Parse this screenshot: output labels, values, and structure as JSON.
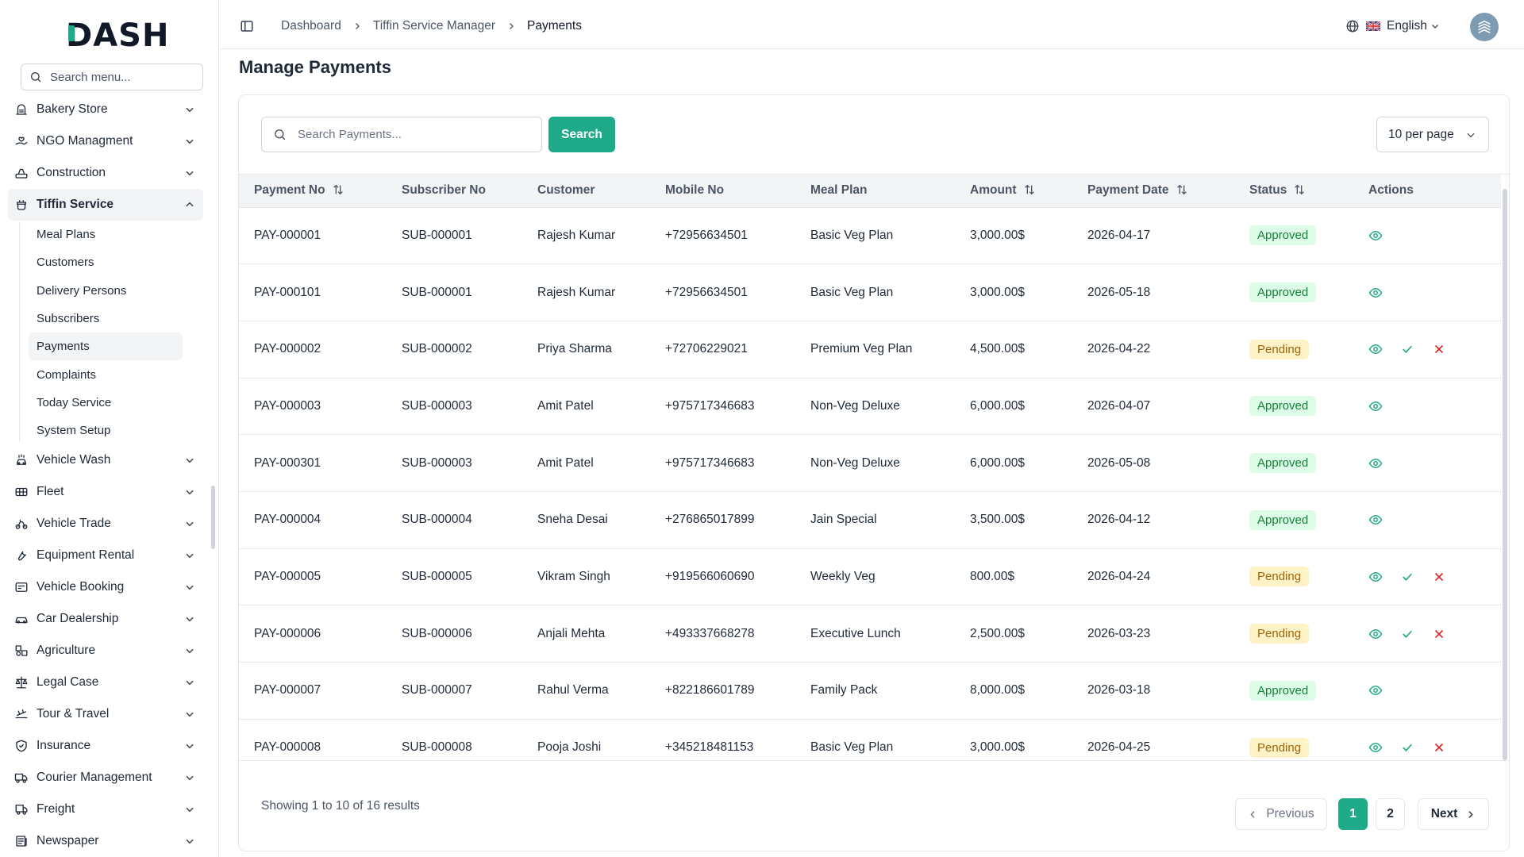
{
  "brand": {
    "logo_text": "DASH"
  },
  "sidebar": {
    "search_placeholder": "Search menu...",
    "items": [
      {
        "label": "Bakery Store",
        "icon": "bakery-icon"
      },
      {
        "label": "NGO Managment",
        "icon": "hand-heart-icon"
      },
      {
        "label": "Construction",
        "icon": "construction-icon"
      },
      {
        "label": "Tiffin Service",
        "icon": "tiffin-icon",
        "expanded": true
      },
      {
        "label": "Vehicle Wash",
        "icon": "car-wash-icon"
      },
      {
        "label": "Fleet",
        "icon": "fleet-icon"
      },
      {
        "label": "Vehicle Trade",
        "icon": "vehicle-trade-icon"
      },
      {
        "label": "Equipment Rental",
        "icon": "wrench-icon"
      },
      {
        "label": "Vehicle Booking",
        "icon": "booking-icon"
      },
      {
        "label": "Car Dealership",
        "icon": "car-icon"
      },
      {
        "label": "Agriculture",
        "icon": "agriculture-icon"
      },
      {
        "label": "Legal Case",
        "icon": "scale-icon"
      },
      {
        "label": "Tour & Travel",
        "icon": "travel-icon"
      },
      {
        "label": "Insurance",
        "icon": "shield-icon"
      },
      {
        "label": "Courier Management",
        "icon": "truck-icon"
      },
      {
        "label": "Freight",
        "icon": "freight-icon"
      },
      {
        "label": "Newspaper",
        "icon": "newspaper-icon"
      }
    ],
    "submenu": [
      {
        "label": "Meal Plans"
      },
      {
        "label": "Customers"
      },
      {
        "label": "Delivery Persons"
      },
      {
        "label": "Subscribers"
      },
      {
        "label": "Payments",
        "active": true
      },
      {
        "label": "Complaints"
      },
      {
        "label": "Today Service"
      },
      {
        "label": "System Setup"
      }
    ]
  },
  "header": {
    "breadcrumbs": [
      "Dashboard",
      "Tiffin Service Manager",
      "Payments"
    ],
    "language": "English"
  },
  "main": {
    "title": "Manage Payments",
    "search_placeholder": "Search Payments...",
    "search_button": "Search",
    "per_page": "10 per page",
    "columns": [
      "Payment No",
      "Subscriber No",
      "Customer",
      "Mobile No",
      "Meal Plan",
      "Amount",
      "Payment Date",
      "Status",
      "Actions"
    ],
    "rows": [
      {
        "payment_no": "PAY-000001",
        "subscriber_no": "SUB-000001",
        "customer": "Rajesh Kumar",
        "mobile": "+72956634501",
        "meal_plan": "Basic Veg Plan",
        "amount": "3,000.00$",
        "date": "2026-04-17",
        "status": "Approved"
      },
      {
        "payment_no": "PAY-000101",
        "subscriber_no": "SUB-000001",
        "customer": "Rajesh Kumar",
        "mobile": "+72956634501",
        "meal_plan": "Basic Veg Plan",
        "amount": "3,000.00$",
        "date": "2026-05-18",
        "status": "Approved"
      },
      {
        "payment_no": "PAY-000002",
        "subscriber_no": "SUB-000002",
        "customer": "Priya Sharma",
        "mobile": "+72706229021",
        "meal_plan": "Premium Veg Plan",
        "amount": "4,500.00$",
        "date": "2026-04-22",
        "status": "Pending"
      },
      {
        "payment_no": "PAY-000003",
        "subscriber_no": "SUB-000003",
        "customer": "Amit Patel",
        "mobile": "+975717346683",
        "meal_plan": "Non-Veg Deluxe",
        "amount": "6,000.00$",
        "date": "2026-04-07",
        "status": "Approved"
      },
      {
        "payment_no": "PAY-000301",
        "subscriber_no": "SUB-000003",
        "customer": "Amit Patel",
        "mobile": "+975717346683",
        "meal_plan": "Non-Veg Deluxe",
        "amount": "6,000.00$",
        "date": "2026-05-08",
        "status": "Approved"
      },
      {
        "payment_no": "PAY-000004",
        "subscriber_no": "SUB-000004",
        "customer": "Sneha Desai",
        "mobile": "+276865017899",
        "meal_plan": "Jain Special",
        "amount": "3,500.00$",
        "date": "2026-04-12",
        "status": "Approved"
      },
      {
        "payment_no": "PAY-000005",
        "subscriber_no": "SUB-000005",
        "customer": "Vikram Singh",
        "mobile": "+919566060690",
        "meal_plan": "Weekly Veg",
        "amount": "800.00$",
        "date": "2026-04-24",
        "status": "Pending"
      },
      {
        "payment_no": "PAY-000006",
        "subscriber_no": "SUB-000006",
        "customer": "Anjali Mehta",
        "mobile": "+493337668278",
        "meal_plan": "Executive Lunch",
        "amount": "2,500.00$",
        "date": "2026-03-23",
        "status": "Pending"
      },
      {
        "payment_no": "PAY-000007",
        "subscriber_no": "SUB-000007",
        "customer": "Rahul Verma",
        "mobile": "+822186601789",
        "meal_plan": "Family Pack",
        "amount": "8,000.00$",
        "date": "2026-03-18",
        "status": "Approved"
      },
      {
        "payment_no": "PAY-000008",
        "subscriber_no": "SUB-000008",
        "customer": "Pooja Joshi",
        "mobile": "+345218481153",
        "meal_plan": "Basic Veg Plan",
        "amount": "3,000.00$",
        "date": "2026-04-25",
        "status": "Pending"
      }
    ],
    "pagination": {
      "info": "Showing 1 to 10 of 16 results",
      "previous": "Previous",
      "next": "Next",
      "pages": [
        "1",
        "2"
      ],
      "current": "1"
    }
  },
  "colors": {
    "accent": "#1fab89",
    "approved_bg": "#dcfce7",
    "approved_text": "#15803d",
    "pending_bg": "#fef3c7",
    "pending_text": "#a16207",
    "reject": "#dc2626"
  }
}
